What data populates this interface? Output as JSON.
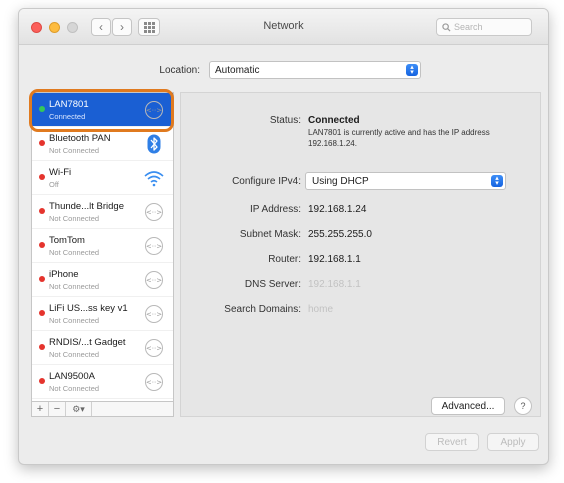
{
  "window": {
    "title": "Network",
    "search_placeholder": "Search",
    "nav_back_label": "‹",
    "nav_forward_label": "›"
  },
  "location": {
    "label": "Location:",
    "value": "Automatic"
  },
  "colors": {
    "accent": "#1a5fd3",
    "status_connected": "#34c759",
    "status_not_connected": "#e5342d",
    "highlight": "#e07a1f"
  },
  "sidebar": {
    "services": [
      {
        "name": "LAN7801",
        "status": "Connected",
        "state": "connected",
        "selected": true,
        "icon": "ethernet-icon"
      },
      {
        "name": "Bluetooth PAN",
        "status": "Not Connected",
        "state": "not-connected",
        "selected": false,
        "icon": "bluetooth-icon"
      },
      {
        "name": "Wi-Fi",
        "status": "Off",
        "state": "not-connected",
        "selected": false,
        "icon": "wifi-icon"
      },
      {
        "name": "Thunde...lt Bridge",
        "status": "Not Connected",
        "state": "not-connected",
        "selected": false,
        "icon": "ethernet-icon"
      },
      {
        "name": "TomTom",
        "status": "Not Connected",
        "state": "not-connected",
        "selected": false,
        "icon": "ethernet-icon"
      },
      {
        "name": "iPhone",
        "status": "Not Connected",
        "state": "not-connected",
        "selected": false,
        "icon": "ethernet-icon"
      },
      {
        "name": "LiFi US...ss key v1",
        "status": "Not Connected",
        "state": "not-connected",
        "selected": false,
        "icon": "ethernet-icon"
      },
      {
        "name": "RNDIS/...t Gadget",
        "status": "Not Connected",
        "state": "not-connected",
        "selected": false,
        "icon": "ethernet-icon"
      },
      {
        "name": "LAN9500A",
        "status": "Not Connected",
        "state": "not-connected",
        "selected": false,
        "icon": "ethernet-icon"
      }
    ],
    "footer": {
      "add_label": "+",
      "remove_label": "−",
      "gear_label": "⚙▾"
    }
  },
  "detail": {
    "status_label": "Status:",
    "status_value": "Connected",
    "status_description": "LAN7801 is currently active and has the IP address 192.168.1.24.",
    "configure_label": "Configure IPv4:",
    "configure_value": "Using DHCP",
    "ip_label": "IP Address:",
    "ip_value": "192.168.1.24",
    "subnet_label": "Subnet Mask:",
    "subnet_value": "255.255.255.0",
    "router_label": "Router:",
    "router_value": "192.168.1.1",
    "dns_label": "DNS Server:",
    "dns_value": "192.168.1.1",
    "search_domains_label": "Search Domains:",
    "search_domains_value": "home",
    "advanced_label": "Advanced...",
    "help_label": "?"
  },
  "buttons": {
    "revert_label": "Revert",
    "apply_label": "Apply"
  }
}
